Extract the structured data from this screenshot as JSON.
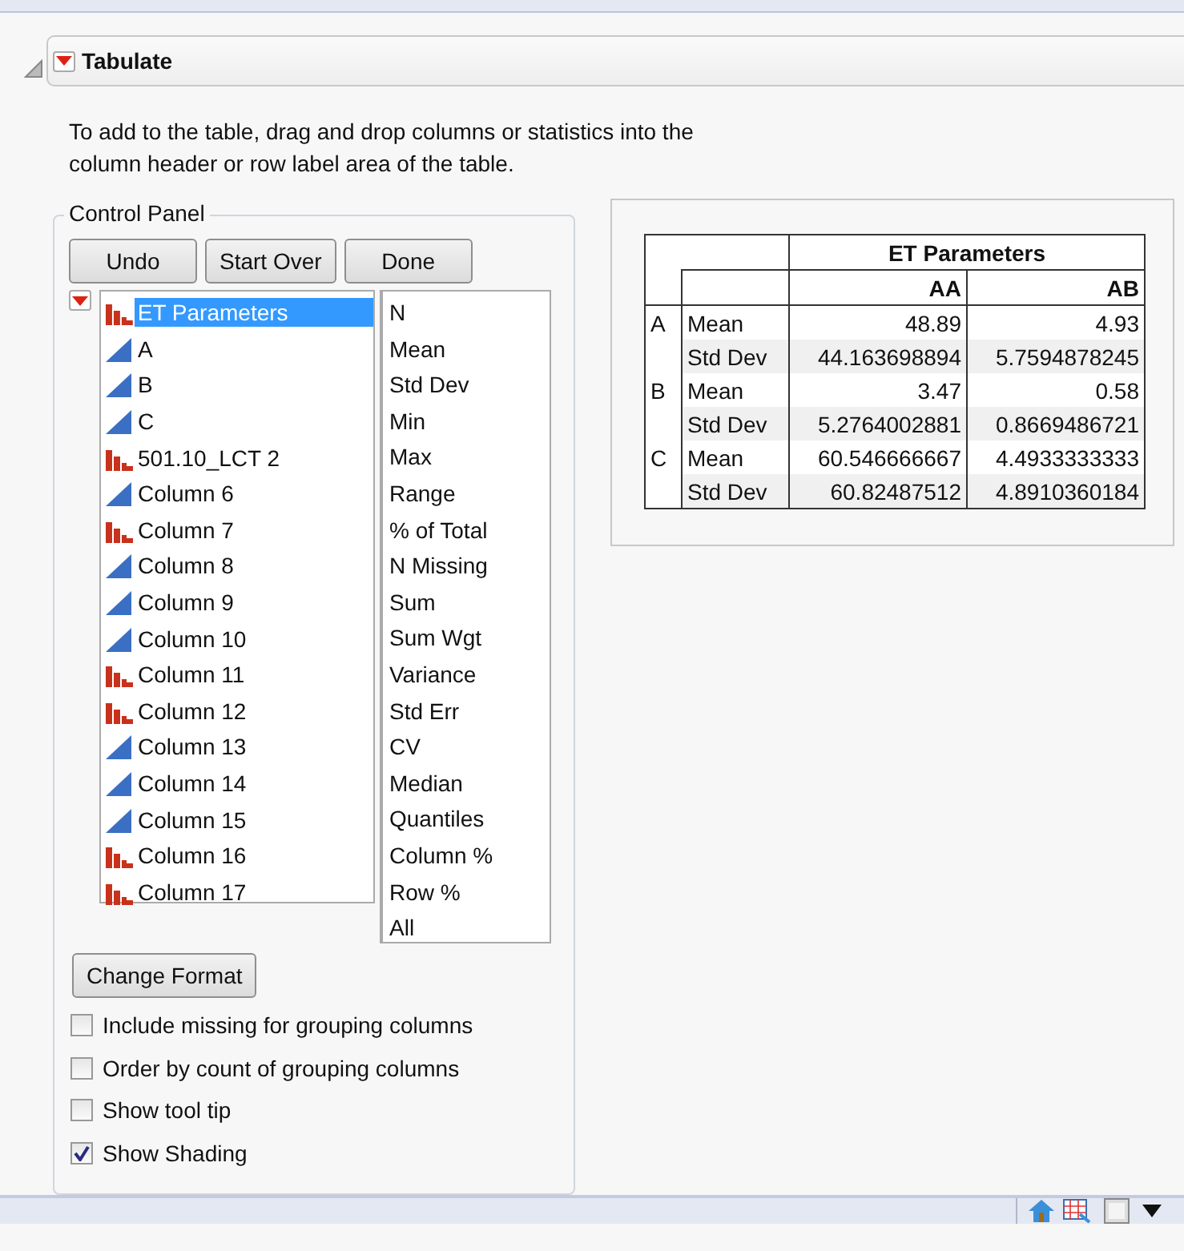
{
  "outline": {
    "title": "Tabulate",
    "expanded": true
  },
  "instructions": "To add to the table, drag and drop columns or statistics into the column header or row label area of the table.",
  "control_panel": {
    "title": "Control Panel",
    "buttons": [
      "Undo",
      "Start Over",
      "Done"
    ],
    "columns": [
      {
        "label": "ET Parameters",
        "kind": "nominal",
        "selected": true
      },
      {
        "label": "A",
        "kind": "continuous",
        "selected": false
      },
      {
        "label": "B",
        "kind": "continuous",
        "selected": false
      },
      {
        "label": "C",
        "kind": "continuous",
        "selected": false
      },
      {
        "label": "501.10_LCT 2",
        "kind": "nominal",
        "selected": false
      },
      {
        "label": "Column 6",
        "kind": "continuous",
        "selected": false
      },
      {
        "label": "Column 7",
        "kind": "nominal",
        "selected": false
      },
      {
        "label": "Column 8",
        "kind": "continuous",
        "selected": false
      },
      {
        "label": "Column 9",
        "kind": "continuous",
        "selected": false
      },
      {
        "label": "Column 10",
        "kind": "continuous",
        "selected": false
      },
      {
        "label": "Column 11",
        "kind": "nominal",
        "selected": false
      },
      {
        "label": "Column 12",
        "kind": "nominal",
        "selected": false
      },
      {
        "label": "Column 13",
        "kind": "continuous",
        "selected": false
      },
      {
        "label": "Column 14",
        "kind": "continuous",
        "selected": false
      },
      {
        "label": "Column 15",
        "kind": "continuous",
        "selected": false
      },
      {
        "label": "Column 16",
        "kind": "nominal",
        "selected": false
      },
      {
        "label": "Column 17",
        "kind": "nominal",
        "selected": false
      }
    ],
    "statistics": [
      "N",
      "Mean",
      "Std Dev",
      "Min",
      "Max",
      "Range",
      "% of Total",
      "N Missing",
      "Sum",
      "Sum Wgt",
      "Variance",
      "Std Err",
      "CV",
      "Median",
      "Quantiles",
      "Column %",
      "Row %",
      "All"
    ],
    "format_button": "Change Format",
    "options": [
      {
        "label": "Include missing for grouping columns",
        "checked": false
      },
      {
        "label": "Order by count of grouping columns",
        "checked": false
      },
      {
        "label": "Show tool tip",
        "checked": false
      },
      {
        "label": "Show Shading",
        "checked": true
      }
    ]
  },
  "table": {
    "header": "ET Parameters",
    "columns": [
      "AA",
      "AB"
    ],
    "rows": [
      {
        "group": "A",
        "stat": "Mean",
        "values": [
          "48.89",
          "4.93"
        ]
      },
      {
        "group": "",
        "stat": "Std Dev",
        "values": [
          "44.163698894",
          "5.7594878245"
        ]
      },
      {
        "group": "B",
        "stat": "Mean",
        "values": [
          "3.47",
          "0.58"
        ]
      },
      {
        "group": "",
        "stat": "Std Dev",
        "values": [
          "5.2764002881",
          "0.8669486721"
        ]
      },
      {
        "group": "C",
        "stat": "Mean",
        "values": [
          "60.546666667",
          "4.4933333333"
        ]
      },
      {
        "group": "",
        "stat": "Std Dev",
        "values": [
          "60.82487512",
          "4.8910360184"
        ]
      }
    ]
  }
}
